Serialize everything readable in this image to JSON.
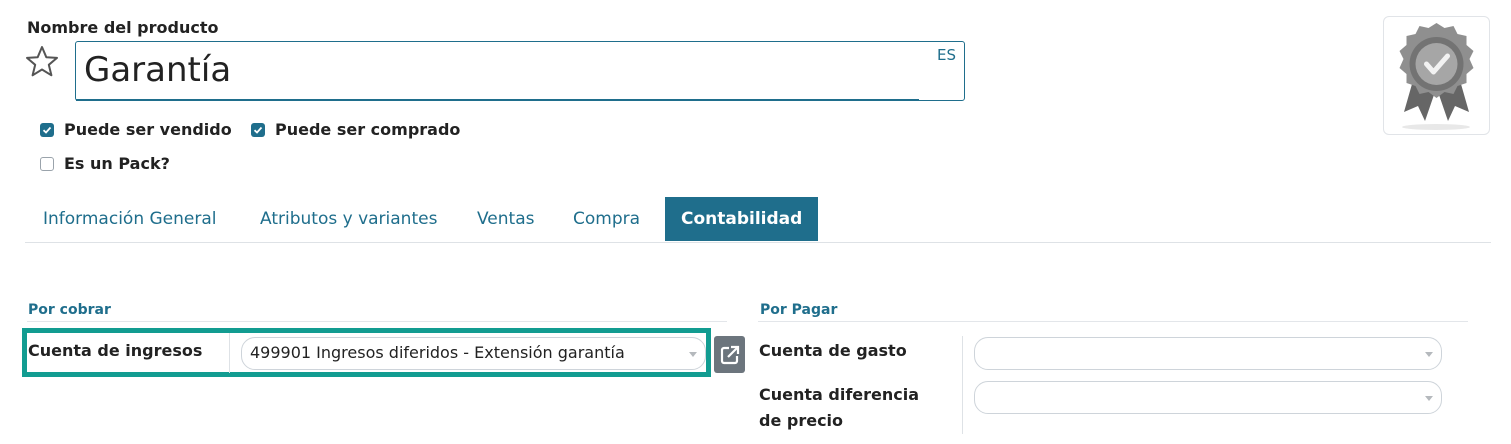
{
  "product": {
    "name_label": "Nombre del producto",
    "name_value": "Garantía",
    "lang_code": "ES"
  },
  "checkboxes": [
    {
      "label": "Puede ser vendido",
      "checked": true
    },
    {
      "label": "Puede ser comprado",
      "checked": true
    },
    {
      "label": "Es un Pack?",
      "checked": false
    }
  ],
  "tabs": [
    {
      "label": "Información General",
      "active": false
    },
    {
      "label": "Atributos y variantes",
      "active": false
    },
    {
      "label": "Ventas",
      "active": false
    },
    {
      "label": "Compra",
      "active": false
    },
    {
      "label": "Contabilidad",
      "active": true
    }
  ],
  "receivable": {
    "section_title": "Por cobrar",
    "income_account_label": "Cuenta de ingresos",
    "income_account_value": "499901 Ingresos diferidos - Extensión garantía"
  },
  "payable": {
    "section_title": "Por Pagar",
    "expense_account_label": "Cuenta de gasto",
    "expense_account_value": "",
    "price_diff_label_line1": "Cuenta diferencia",
    "price_diff_label_line2": "de precio",
    "price_diff_value": ""
  },
  "colors": {
    "accent": "#1f6e8c",
    "highlight": "#129c91"
  },
  "icons": {
    "favorite": "star-icon",
    "external": "external-link-icon",
    "product_image": "badge-check-icon"
  }
}
